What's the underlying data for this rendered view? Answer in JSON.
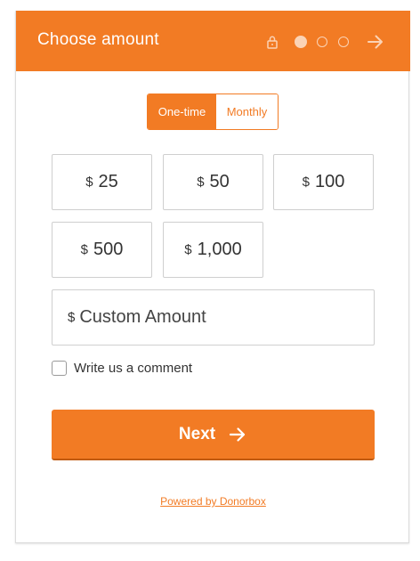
{
  "header": {
    "title": "Choose amount",
    "step_current": 1,
    "step_total": 3,
    "icons": [
      "lock-icon",
      "arrow-right-icon"
    ]
  },
  "frequency": {
    "options": [
      "One-time",
      "Monthly"
    ],
    "selected": "One-time"
  },
  "amounts": [
    {
      "currency": "$",
      "value": "25"
    },
    {
      "currency": "$",
      "value": "50"
    },
    {
      "currency": "$",
      "value": "100"
    },
    {
      "currency": "$",
      "value": "500"
    },
    {
      "currency": "$",
      "value": "1,000"
    }
  ],
  "custom_amount": {
    "currency": "$",
    "placeholder": "Custom Amount"
  },
  "comment": {
    "label": "Write us a comment",
    "checked": false
  },
  "next_button": {
    "label": "Next"
  },
  "footer": {
    "powered_by": "Powered by Donorbox"
  },
  "colors": {
    "accent": "#f27b24",
    "border": "#cfcfcf"
  }
}
